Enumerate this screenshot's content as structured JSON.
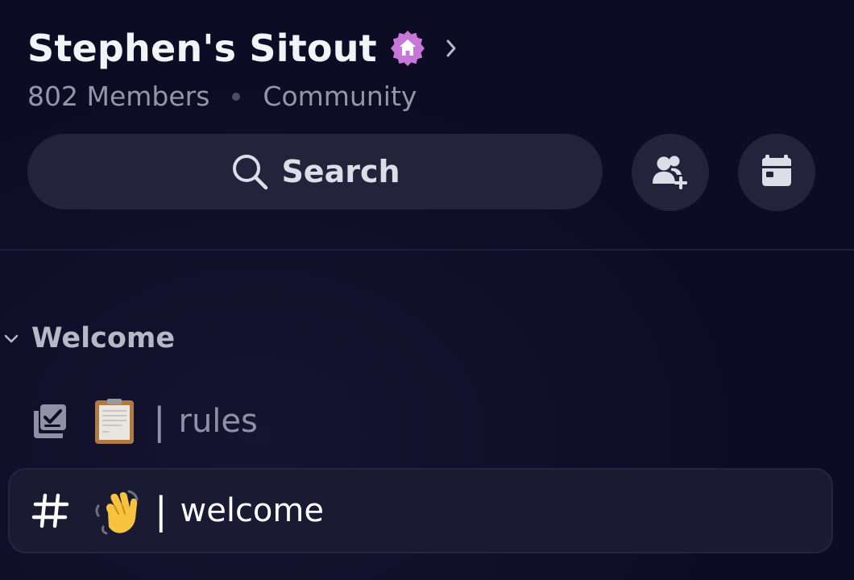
{
  "server": {
    "name": "Stephen's Sitout",
    "badge_icon": "community-home-badge-icon",
    "members": "802 Members",
    "type": "Community"
  },
  "search": {
    "label": "Search"
  },
  "actions": {
    "invite_icon": "add-member-icon",
    "events_icon": "calendar-icon"
  },
  "category": {
    "label": "Welcome"
  },
  "channels": [
    {
      "icon": "rules-checkbox-icon",
      "emoji": "clipboard",
      "separator": "|",
      "name": "rules",
      "selected": false
    },
    {
      "icon": "hash-icon",
      "emoji": "waving-hand",
      "separator": "|",
      "name": "welcome",
      "selected": true
    }
  ],
  "colors": {
    "background": "#0d0c24",
    "pill": "#23233c",
    "badge": "#c777d8",
    "text_primary": "#f2f3f5",
    "text_muted": "#9496a8"
  }
}
